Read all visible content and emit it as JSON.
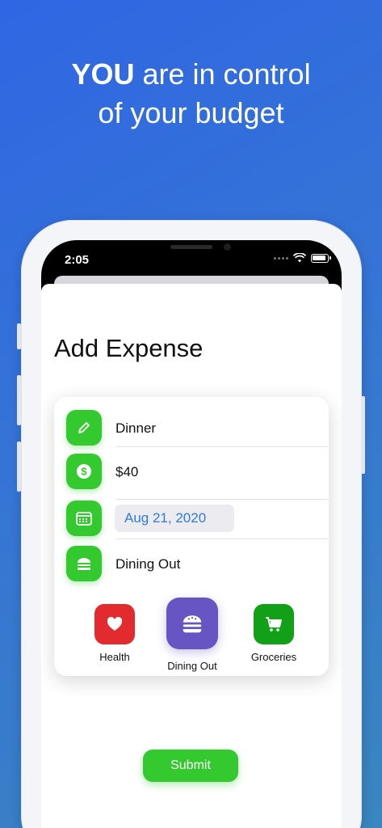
{
  "headline": {
    "bold": "YOU",
    "rest": " are in control",
    "line2": "of your budget"
  },
  "status": {
    "time": "2:05"
  },
  "screen": {
    "title": "Add Expense",
    "fields": {
      "name": "Dinner",
      "amount": "$40",
      "date": "Aug 21, 2020",
      "category": "Dining Out"
    },
    "categories": [
      {
        "label": "Health",
        "color": "#e32a2e",
        "icon": "heart-icon"
      },
      {
        "label": "Dining Out",
        "color": "#6655c2",
        "icon": "burger-icon",
        "selected": true
      },
      {
        "label": "Groceries",
        "color": "#12a018",
        "icon": "cart-icon"
      }
    ],
    "submit_label": "Submit"
  },
  "colors": {
    "accent_green": "#34c92e",
    "date_blue": "#2f7be0"
  }
}
